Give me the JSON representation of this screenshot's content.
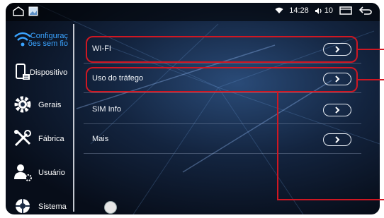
{
  "status_bar": {
    "time": "14:28",
    "volume": "10",
    "icons": [
      "home-outline-icon",
      "image-thumb-icon",
      "wifi-icon",
      "volume-icon",
      "recent-apps-icon",
      "back-icon"
    ]
  },
  "sidebar": {
    "items": [
      {
        "label": "Configuraç ões sem fio",
        "icon": "wifi-icon",
        "active": true
      },
      {
        "label": "Dispositivo",
        "icon": "phone-device-icon"
      },
      {
        "label": "Gerais",
        "icon": "gear-icon"
      },
      {
        "label": "Fábrica",
        "icon": "tools-icon"
      },
      {
        "label": "Usuário",
        "icon": "user-gear-icon"
      },
      {
        "label": "Sistema",
        "icon": "system-gear-icon"
      }
    ]
  },
  "main": {
    "rows": [
      {
        "label": "WI-FI",
        "highlighted": true
      },
      {
        "label": "Uso do tráfego",
        "highlighted": true
      },
      {
        "label": "SIM Info",
        "highlighted": false
      },
      {
        "label": "Mais",
        "highlighted": false
      }
    ]
  },
  "colors": {
    "accent": "#3aa3ff",
    "highlight": "#d01722",
    "background": "#0b1628"
  }
}
